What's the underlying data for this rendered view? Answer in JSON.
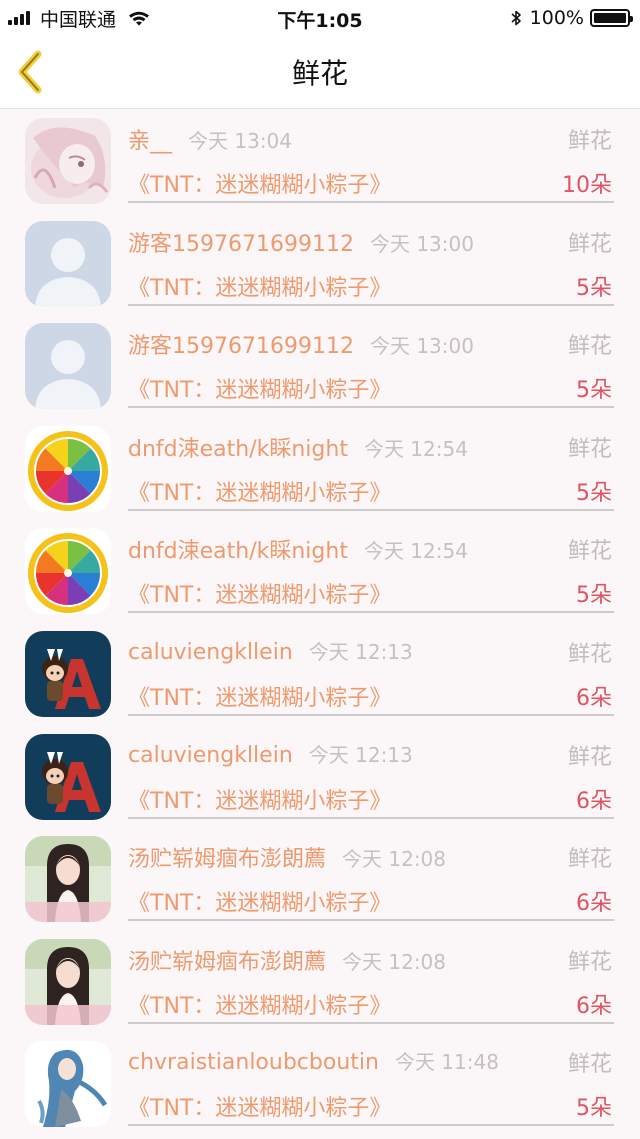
{
  "status_bar": {
    "carrier": "中国联通",
    "time": "下午1:05",
    "battery": "100%",
    "icons": [
      "signal-icon",
      "wifi-icon",
      "bluetooth-icon",
      "battery-icon"
    ]
  },
  "nav": {
    "title": "鲜花",
    "back_icon": "chevron-left-icon"
  },
  "colors": {
    "accent": "#ef9a6e",
    "count": "#e05361",
    "muted": "#c6c0c1",
    "nav_back": "#f4cd34"
  },
  "records": [
    {
      "user": "亲__",
      "time": "今天 13:04",
      "gift": "鲜花",
      "work": "《TNT：迷迷糊糊小粽子》",
      "count": "10朵",
      "avatar": "pink-anime-avatar"
    },
    {
      "user": "游客1597671699112",
      "time": "今天 13:00",
      "gift": "鲜花",
      "work": "《TNT：迷迷糊糊小粽子》",
      "count": "5朵",
      "avatar": "default-user-avatar"
    },
    {
      "user": "游客1597671699112",
      "time": "今天 13:00",
      "gift": "鲜花",
      "work": "《TNT：迷迷糊糊小粽子》",
      "count": "5朵",
      "avatar": "default-user-avatar"
    },
    {
      "user": "dnfd涑eath/k睬night",
      "time": "今天 12:54",
      "gift": "鲜花",
      "work": "《TNT：迷迷糊糊小粽子》",
      "count": "5朵",
      "avatar": "color-wheel-avatar"
    },
    {
      "user": "dnfd涑eath/k睬night",
      "time": "今天 12:54",
      "gift": "鲜花",
      "work": "《TNT：迷迷糊糊小粽子》",
      "count": "5朵",
      "avatar": "color-wheel-avatar"
    },
    {
      "user": "caluviengkllein",
      "time": "今天 12:13",
      "gift": "鲜花",
      "work": "《TNT：迷迷糊糊小粽子》",
      "count": "6朵",
      "avatar": "letter-a-avatar"
    },
    {
      "user": "caluviengkllein",
      "time": "今天 12:13",
      "gift": "鲜花",
      "work": "《TNT：迷迷糊糊小粽子》",
      "count": "6朵",
      "avatar": "letter-a-avatar"
    },
    {
      "user": "汤贮崭姆痼布澎朗薦",
      "time": "今天 12:08",
      "gift": "鲜花",
      "work": "《TNT：迷迷糊糊小粽子》",
      "count": "6朵",
      "avatar": "girl-photo-avatar"
    },
    {
      "user": "汤贮崭姆痼布澎朗薦",
      "time": "今天 12:08",
      "gift": "鲜花",
      "work": "《TNT：迷迷糊糊小粽子》",
      "count": "6朵",
      "avatar": "girl-photo-avatar"
    },
    {
      "user": "chvraistianloubcboutin",
      "time": "今天 11:48",
      "gift": "鲜花",
      "work": "《TNT：迷迷糊糊小粽子》",
      "count": "5朵",
      "avatar": "blue-hair-avatar"
    }
  ]
}
